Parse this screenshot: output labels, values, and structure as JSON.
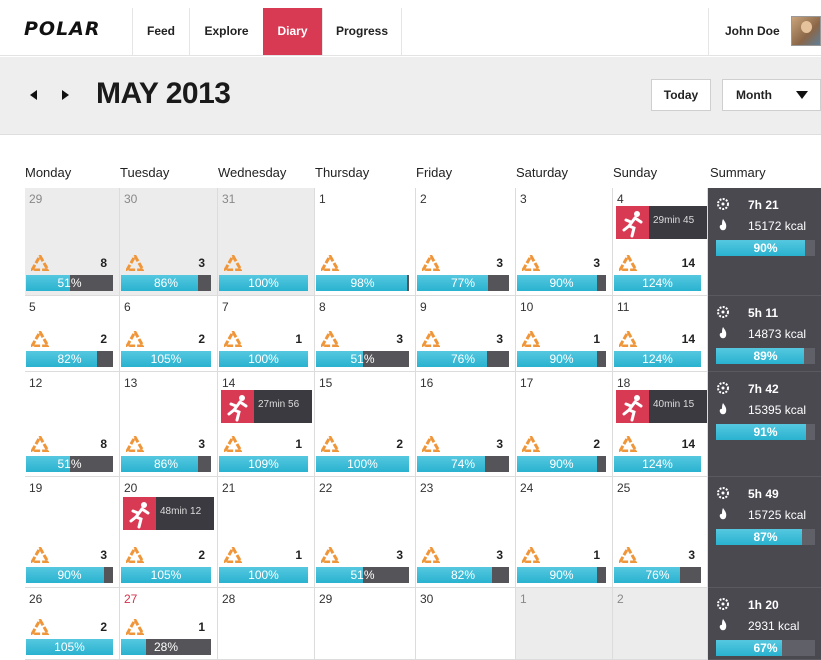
{
  "app": {
    "logo": "POLAR"
  },
  "nav": {
    "tabs": [
      {
        "label": "Feed",
        "active": false
      },
      {
        "label": "Explore",
        "active": false
      },
      {
        "label": "Diary",
        "active": true
      },
      {
        "label": "Progress",
        "active": false
      }
    ],
    "user_name": "John Doe"
  },
  "header": {
    "title": "MAY 2013",
    "today_label": "Today",
    "view_label": "Month"
  },
  "weekdays": [
    "Monday",
    "Tuesday",
    "Wednesday",
    "Thursday",
    "Friday",
    "Saturday",
    "Sunday",
    "Summary"
  ],
  "colors": {
    "accent": "#d83a54",
    "progress": "#29b2cf",
    "summary_bg": "#4a4950",
    "activity_icon": "#f0963a"
  },
  "weeks": [
    {
      "days": [
        {
          "day": "29",
          "other_month": true,
          "count": "8",
          "percent": "51%",
          "progress": 0.51
        },
        {
          "day": "30",
          "other_month": true,
          "count": "3",
          "percent": "86%",
          "progress": 0.86
        },
        {
          "day": "31",
          "other_month": true,
          "count": "",
          "percent": "100%",
          "progress": 1.0
        },
        {
          "day": "1",
          "other_month": false,
          "count": "",
          "percent": "98%",
          "progress": 0.98
        },
        {
          "day": "2",
          "other_month": false,
          "count": "3",
          "percent": "77%",
          "progress": 0.77
        },
        {
          "day": "3",
          "other_month": false,
          "count": "3",
          "percent": "90%",
          "progress": 0.9
        },
        {
          "day": "4",
          "other_month": false,
          "count": "14",
          "percent": "124%",
          "progress": 1.0,
          "workout": "29min 45"
        }
      ],
      "summary": {
        "time": "7h 21",
        "kcal": "15172 kcal",
        "percent": "90%",
        "progress": 0.9
      }
    },
    {
      "days": [
        {
          "day": "5",
          "other_month": false,
          "count": "2",
          "percent": "82%",
          "progress": 0.82
        },
        {
          "day": "6",
          "other_month": false,
          "count": "2",
          "percent": "105%",
          "progress": 1.0
        },
        {
          "day": "7",
          "other_month": false,
          "count": "1",
          "percent": "100%",
          "progress": 1.0
        },
        {
          "day": "8",
          "other_month": false,
          "count": "3",
          "percent": "51%",
          "progress": 0.51
        },
        {
          "day": "9",
          "other_month": false,
          "count": "3",
          "percent": "76%",
          "progress": 0.76
        },
        {
          "day": "10",
          "other_month": false,
          "count": "1",
          "percent": "90%",
          "progress": 0.9
        },
        {
          "day": "11",
          "other_month": false,
          "count": "14",
          "percent": "124%",
          "progress": 1.0
        }
      ],
      "summary": {
        "time": "5h 11",
        "kcal": "14873 kcal",
        "percent": "89%",
        "progress": 0.89
      }
    },
    {
      "days": [
        {
          "day": "12",
          "other_month": false,
          "count": "8",
          "percent": "51%",
          "progress": 0.51
        },
        {
          "day": "13",
          "other_month": false,
          "count": "3",
          "percent": "86%",
          "progress": 0.86
        },
        {
          "day": "14",
          "other_month": false,
          "count": "1",
          "percent": "109%",
          "progress": 1.0,
          "workout": "27min 56"
        },
        {
          "day": "15",
          "other_month": false,
          "count": "2",
          "percent": "100%",
          "progress": 1.0
        },
        {
          "day": "16",
          "other_month": false,
          "count": "3",
          "percent": "74%",
          "progress": 0.74
        },
        {
          "day": "17",
          "other_month": false,
          "count": "2",
          "percent": "90%",
          "progress": 0.9
        },
        {
          "day": "18",
          "other_month": false,
          "count": "14",
          "percent": "124%",
          "progress": 1.0,
          "workout": "40min 15"
        }
      ],
      "summary": {
        "time": "7h 42",
        "kcal": "15395 kcal",
        "percent": "91%",
        "progress": 0.91
      }
    },
    {
      "days": [
        {
          "day": "19",
          "other_month": false,
          "count": "3",
          "percent": "90%",
          "progress": 0.9
        },
        {
          "day": "20",
          "other_month": false,
          "count": "2",
          "percent": "105%",
          "progress": 1.0,
          "workout": "48min 12"
        },
        {
          "day": "21",
          "other_month": false,
          "count": "1",
          "percent": "100%",
          "progress": 1.0
        },
        {
          "day": "22",
          "other_month": false,
          "count": "3",
          "percent": "51%",
          "progress": 0.51
        },
        {
          "day": "23",
          "other_month": false,
          "count": "3",
          "percent": "82%",
          "progress": 0.82
        },
        {
          "day": "24",
          "other_month": false,
          "count": "1",
          "percent": "90%",
          "progress": 0.9
        },
        {
          "day": "25",
          "other_month": false,
          "count": "3",
          "percent": "76%",
          "progress": 0.76
        }
      ],
      "summary": {
        "time": "5h 49",
        "kcal": "15725 kcal",
        "percent": "87%",
        "progress": 0.87
      }
    },
    {
      "days": [
        {
          "day": "26",
          "other_month": false,
          "count": "2",
          "percent": "105%",
          "progress": 1.0
        },
        {
          "day": "27",
          "other_month": false,
          "today": true,
          "count": "1",
          "percent": "28%",
          "progress": 0.28
        },
        {
          "day": "28",
          "other_month": false,
          "empty": true
        },
        {
          "day": "29",
          "other_month": false,
          "empty": true
        },
        {
          "day": "30",
          "other_month": false,
          "empty": true
        },
        {
          "day": "1",
          "other_month": true,
          "empty": true
        },
        {
          "day": "2",
          "other_month": true,
          "empty": true
        }
      ],
      "summary": {
        "time": "1h 20",
        "kcal": "2931 kcal",
        "percent": "67%",
        "progress": 0.67
      }
    }
  ]
}
